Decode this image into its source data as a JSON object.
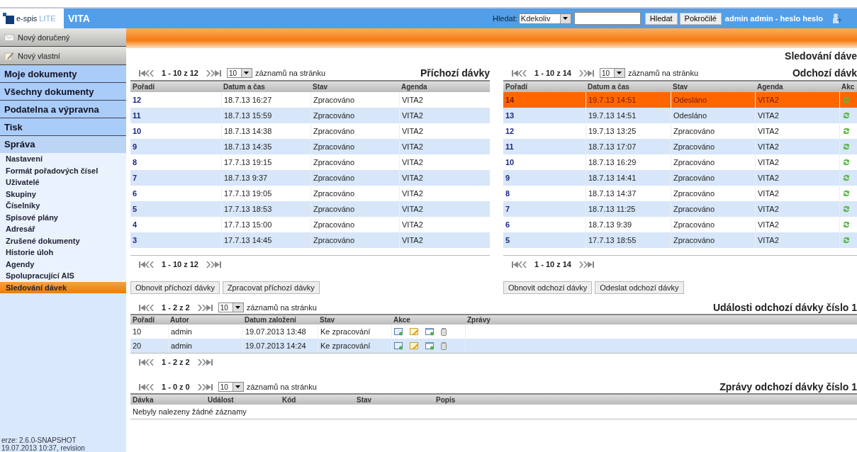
{
  "header": {
    "logo": {
      "brand": "e-spis",
      "edition": "LITE"
    },
    "app_name": "VITA",
    "search": {
      "label": "Hledat:",
      "scope": "Kdekoliv"
    },
    "buttons": [
      "Hledat",
      "Pokročilé"
    ],
    "user": "admin admin - heslo heslo"
  },
  "sidebar": {
    "actions": [
      {
        "label": "Nový doručený",
        "kind": "mail"
      },
      {
        "label": "Nový vlastní",
        "kind": "edit"
      }
    ],
    "sections": [
      {
        "label": "Moje dokumenty",
        "expanded": false
      },
      {
        "label": "Všechny dokumenty",
        "expanded": false
      },
      {
        "label": "Podatelna a výpravna",
        "expanded": false
      },
      {
        "label": "Tisk",
        "expanded": false
      },
      {
        "label": "Správa",
        "expanded": true,
        "children": [
          {
            "label": "Nastavení",
            "selected": false
          },
          {
            "label": "Formát pořadových čísel",
            "selected": false
          },
          {
            "label": "Uživatelé",
            "selected": false
          },
          {
            "label": "Skupiny",
            "selected": false
          },
          {
            "label": "Číselníky",
            "selected": false
          },
          {
            "label": "Spisové plány",
            "selected": false
          },
          {
            "label": "Adresář",
            "selected": false
          },
          {
            "label": "Zrušené dokumenty",
            "selected": false
          },
          {
            "label": "Historie úloh",
            "selected": false
          },
          {
            "label": "Agendy",
            "selected": false
          },
          {
            "label": "Spolupracující AIS",
            "selected": false
          },
          {
            "label": "Sledování dávek",
            "selected": true
          }
        ]
      }
    ],
    "version": [
      "erze: 2.6.0-SNAPSHOT",
      "19.07.2013 10:37, revision"
    ]
  },
  "page_title": "Sledování dáve",
  "incoming": {
    "title": "Příchozí dávky",
    "pager": {
      "range": "1 - 10 z 12",
      "per_page": "10",
      "per_page_label": "záznamů na stránku"
    },
    "pager_bottom": "1 - 10 z 12",
    "columns": [
      "Pořadí",
      "Datum a čas",
      "Stav",
      "Agenda"
    ],
    "rows": [
      {
        "cells": [
          "12",
          "18.7.13 16:27",
          "Zpracováno",
          "VITA2"
        ],
        "selected": false
      },
      {
        "cells": [
          "11",
          "18.7.13 15:59",
          "Zpracováno",
          "VITA2"
        ],
        "selected": false
      },
      {
        "cells": [
          "10",
          "18.7.13 14:38",
          "Zpracováno",
          "VITA2"
        ],
        "selected": false
      },
      {
        "cells": [
          "9",
          "18.7.13 14:35",
          "Zpracováno",
          "VITA2"
        ],
        "selected": false
      },
      {
        "cells": [
          "8",
          "17.7.13 19:15",
          "Zpracováno",
          "VITA2"
        ],
        "selected": false
      },
      {
        "cells": [
          "7",
          "18.7.13 9:37",
          "Zpracováno",
          "VITA2"
        ],
        "selected": false
      },
      {
        "cells": [
          "6",
          "17.7.13 19:05",
          "Zpracováno",
          "VITA2"
        ],
        "selected": false
      },
      {
        "cells": [
          "5",
          "17.7.13 18:53",
          "Zpracováno",
          "VITA2"
        ],
        "selected": false
      },
      {
        "cells": [
          "4",
          "17.7.13 15:00",
          "Zpracováno",
          "VITA2"
        ],
        "selected": false
      },
      {
        "cells": [
          "3",
          "17.7.13 14:45",
          "Zpracováno",
          "VITA2"
        ],
        "selected": false
      }
    ],
    "buttons": [
      "Obnovit příchozí dávky",
      "Zpracovat příchozí dávky"
    ]
  },
  "outgoing": {
    "title": "Odchozí dávk",
    "pager": {
      "range": "1 - 10 z 14",
      "per_page": "10",
      "per_page_label": "záznamů na stránku"
    },
    "pager_bottom": "1 - 10 z 14",
    "columns": [
      "Pořadí",
      "Datum a čas",
      "Stav",
      "Agenda",
      "Akc"
    ],
    "rows": [
      {
        "cells": [
          "14",
          "19.7.13 14:51",
          "Odesláno",
          "VITA2"
        ],
        "selected": true
      },
      {
        "cells": [
          "13",
          "19.7.13 14:51",
          "Odesláno",
          "VITA2"
        ],
        "selected": false
      },
      {
        "cells": [
          "12",
          "19.7.13 13:25",
          "Zpracováno",
          "VITA2"
        ],
        "selected": false
      },
      {
        "cells": [
          "11",
          "18.7.13 17:07",
          "Zpracováno",
          "VITA2"
        ],
        "selected": false
      },
      {
        "cells": [
          "10",
          "18.7.13 16:29",
          "Zpracováno",
          "VITA2"
        ],
        "selected": false
      },
      {
        "cells": [
          "9",
          "18.7.13 14:41",
          "Zpracováno",
          "VITA2"
        ],
        "selected": false
      },
      {
        "cells": [
          "8",
          "18.7.13 14:37",
          "Zpracováno",
          "VITA2"
        ],
        "selected": false
      },
      {
        "cells": [
          "7",
          "18.7.13 11:25",
          "Zpracováno",
          "VITA2"
        ],
        "selected": false
      },
      {
        "cells": [
          "6",
          "18.7.13 9:39",
          "Zpracováno",
          "VITA2"
        ],
        "selected": false
      },
      {
        "cells": [
          "5",
          "17.7.13 18:55",
          "Zpracováno",
          "VITA2"
        ],
        "selected": false
      }
    ],
    "buttons": [
      "Obnovit odchozí dávky",
      "Odeslat odchozí dávky"
    ]
  },
  "events": {
    "title": "Události odchozí dávky číslo 1",
    "pager": {
      "range": "1 - 2 z 2",
      "per_page": "10",
      "per_page_label": "záznamů na stránku"
    },
    "pager_bottom": "1 - 2 z 2",
    "columns": [
      "Pořadí",
      "Autor",
      "Datum založení",
      "Stav",
      "Akce",
      "Zprávy"
    ],
    "rows": [
      {
        "cells": [
          "10",
          "admin",
          "19.07.2013 13:48",
          "Ke zpracování"
        ]
      },
      {
        "cells": [
          "20",
          "admin",
          "19.07.2013 14:24",
          "Ke zpracování"
        ]
      }
    ]
  },
  "messages": {
    "title": "Zprávy odchozí dávky číslo 1",
    "pager": {
      "range": "1 - 0 z 0",
      "per_page": "10",
      "per_page_label": "záznamů na stránku"
    },
    "columns": [
      "Dávka",
      "Událost",
      "Kód",
      "Stav",
      "Popis"
    ],
    "empty": "Nebyly nalezeny žádné záznamy"
  }
}
